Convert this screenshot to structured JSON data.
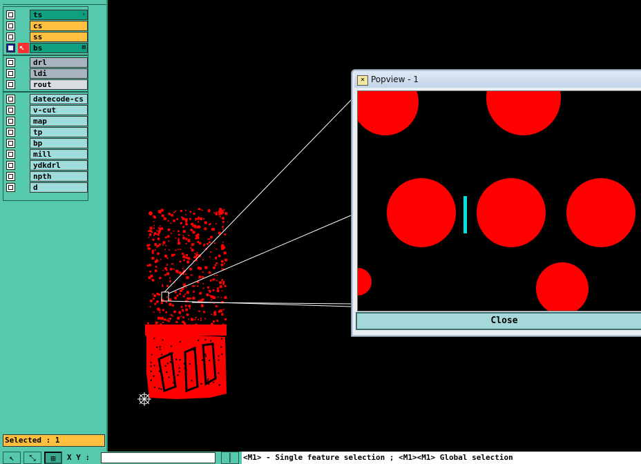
{
  "layers_group1": [
    {
      "name": "ts",
      "color": "#10a080",
      "mark": "✧"
    },
    {
      "name": "cs",
      "color": "#ffc040",
      "mark": ""
    },
    {
      "name": "ss",
      "color": "#ffc040",
      "mark": ""
    },
    {
      "name": "bs",
      "color": "#10a080",
      "mark": "⊞",
      "active": true
    }
  ],
  "layers_group2": [
    {
      "name": "drl",
      "color": "#a8b4c0"
    },
    {
      "name": "ldi",
      "color": "#a8b4c0"
    },
    {
      "name": "rout",
      "color": "#d8dde2"
    }
  ],
  "layers_group3": [
    {
      "name": "datecode-cs",
      "color": "#a0dcdc"
    },
    {
      "name": "v-cut",
      "color": "#a0dcdc"
    },
    {
      "name": "map",
      "color": "#a0dcdc"
    },
    {
      "name": "tp",
      "color": "#a0dcdc"
    },
    {
      "name": "bp",
      "color": "#a0dcdc"
    },
    {
      "name": "mill",
      "color": "#a0dcdc"
    },
    {
      "name": "ydkdrl",
      "color": "#a0dcdc"
    },
    {
      "name": "npth",
      "color": "#a0dcdc"
    },
    {
      "name": "d",
      "color": "#a0dcdc"
    }
  ],
  "status": {
    "selected": "Selected : 1"
  },
  "bottom": {
    "xy_label": "X Y :",
    "hint": "<M1> - Single feature selection ; <M1><M1> Global selection"
  },
  "popview": {
    "title": "Popview - 1",
    "close_label": "Close"
  },
  "colors": {
    "feature": "#ff0000",
    "selected_feature": "#00e0e0",
    "panel": "#56c8ac"
  }
}
